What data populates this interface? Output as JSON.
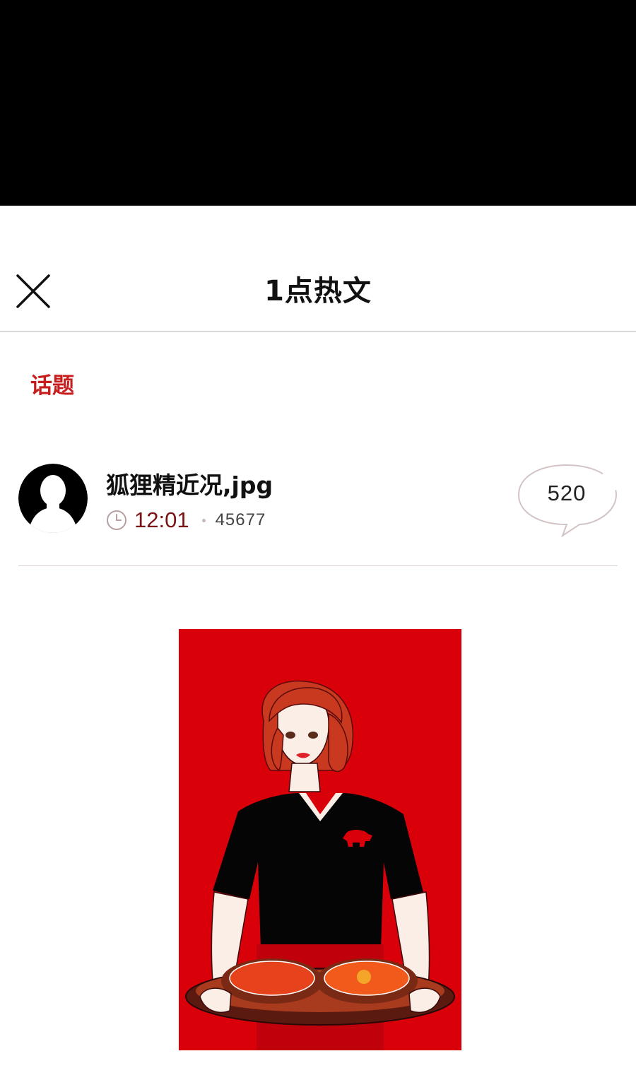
{
  "nav": {
    "title": "1点热文",
    "close_icon": "close-icon"
  },
  "section": {
    "label": "话题"
  },
  "post": {
    "title": "狐狸精近况,jpg",
    "time": "12:01",
    "views": "45677",
    "comments": "520",
    "avatar_icon": "default-avatar-icon",
    "clock_icon": "clock-icon"
  },
  "image": {
    "description_icon": "illustration-woman-serving-pizza"
  },
  "colors": {
    "accent_red": "#c81d1d",
    "time_red": "#7a1414",
    "image_bg": "#d90009"
  }
}
